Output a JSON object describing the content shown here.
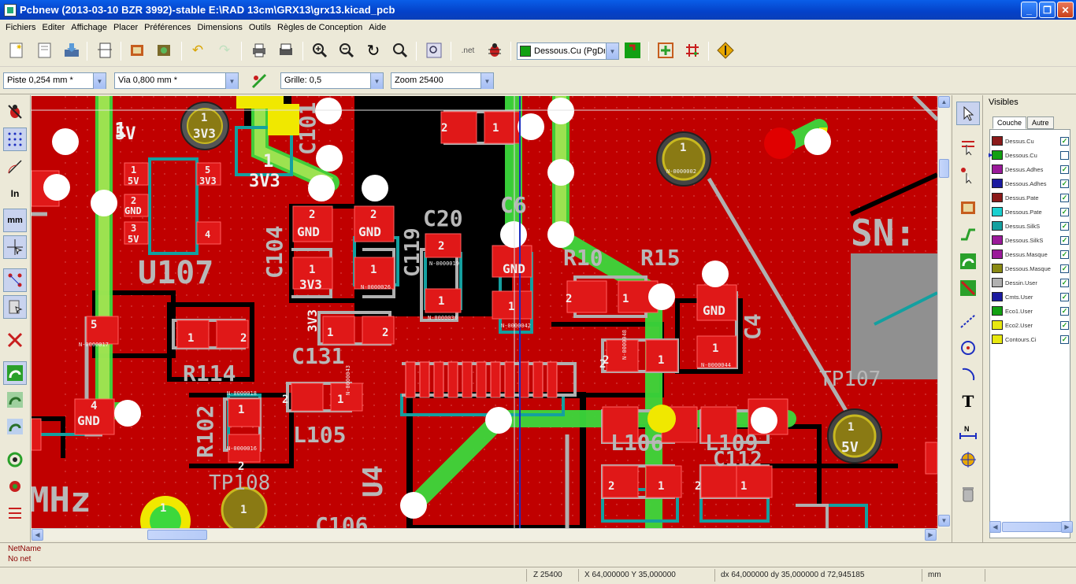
{
  "window": {
    "title": "Pcbnew (2013-03-10 BZR 3992)-stable E:\\RAD 13cm\\GRX13\\grx13.kicad_pcb"
  },
  "menu": [
    "Fichiers",
    "Editer",
    "Affichage",
    "Placer",
    "Préférences",
    "Dimensions",
    "Outils",
    "Règles de Conception",
    "Aide"
  ],
  "toolbar": {
    "net_label": ".net",
    "layer_select": "Dessous.Cu (PgDn)",
    "layer_color": "#12a012"
  },
  "toolbar2": {
    "track": "Piste 0,254 mm *",
    "via": "Via 0,800 mm *",
    "grid": "Grille: 0,5",
    "zoom": "Zoom 25400"
  },
  "layers_panel": {
    "title": "Visibles",
    "tabs": [
      "Couche",
      "Autre"
    ],
    "layers": [
      {
        "name": "Dessus.Cu",
        "color": "#8b1a1a",
        "checked": true
      },
      {
        "name": "Dessous.Cu",
        "color": "#12a012",
        "checked": false,
        "active": true
      },
      {
        "name": "Dessus.Adhes",
        "color": "#9a1a9a",
        "checked": true
      },
      {
        "name": "Dessous.Adhes",
        "color": "#1a1aa0",
        "checked": true
      },
      {
        "name": "Dessus.Pate",
        "color": "#8b1a1a",
        "checked": true
      },
      {
        "name": "Dessous.Pate",
        "color": "#1ad0d0",
        "checked": true
      },
      {
        "name": "Dessus.SilkS",
        "color": "#14a0a0",
        "checked": true
      },
      {
        "name": "Dessous.SilkS",
        "color": "#9a1a9a",
        "checked": true
      },
      {
        "name": "Dessus.Masque",
        "color": "#9a1a9a",
        "checked": true
      },
      {
        "name": "Dessous.Masque",
        "color": "#8a8a14",
        "checked": true
      },
      {
        "name": "Dessin.User",
        "color": "#b0b0b0",
        "checked": true
      },
      {
        "name": "Cmts.User",
        "color": "#1a1aa0",
        "checked": true
      },
      {
        "name": "Eco1.User",
        "color": "#12a012",
        "checked": true
      },
      {
        "name": "Eco2.User",
        "color": "#e8e810",
        "checked": true
      },
      {
        "name": "Contours.Ci",
        "color": "#e8e810",
        "checked": true
      }
    ]
  },
  "pcb": {
    "refs": [
      "U107",
      "C104",
      "C101",
      "C119",
      "C20",
      "C6",
      "R10",
      "R15",
      "C4",
      "SN:",
      "TP107",
      "R114",
      "C131",
      "R102",
      "L105",
      "TP108",
      "U4",
      "L106",
      "L109",
      "C112",
      "C106",
      "MHz"
    ],
    "pad_labels": [
      "1",
      "2",
      "3",
      "4",
      "5",
      "5V",
      "3V3",
      "GND"
    ],
    "nets": [
      "N-0000002",
      "N-0000017",
      "N-0000018",
      "N-0000016",
      "N-0000043",
      "N-0000026",
      "N-0000030",
      "N-0000042",
      "N-0000048",
      "N-0000044",
      "N-0000019"
    ]
  },
  "message": {
    "netname_label": "NetName",
    "netname_value": "No net"
  },
  "status": {
    "zoom": "Z 25400",
    "abs_coords": "X 64,000000  Y 35,000000",
    "rel_coords": "dx 64,000000  dy 35,000000  d 72,945185",
    "units": "mm"
  }
}
